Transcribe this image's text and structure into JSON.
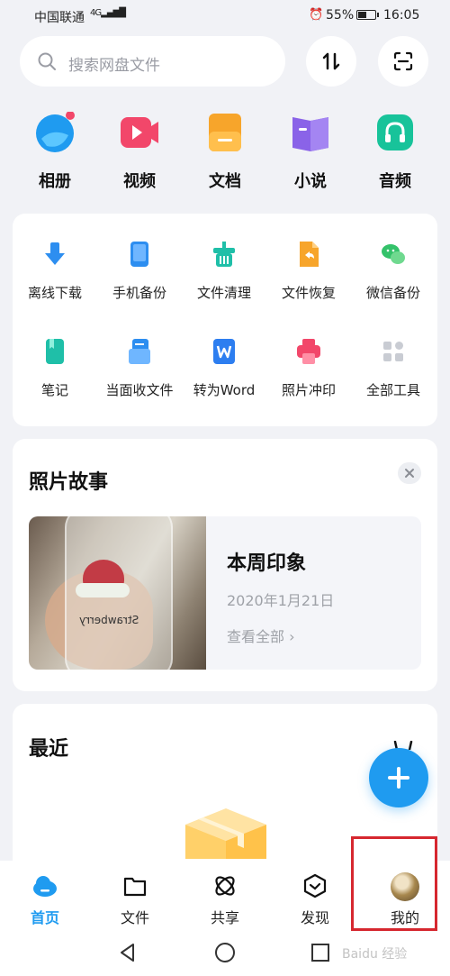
{
  "status_bar": {
    "carrier": "中国联通",
    "signal": "4G",
    "battery": "55%",
    "battery_level": 0.55,
    "time": "16:05"
  },
  "search": {
    "placeholder": "搜索网盘文件",
    "icon": "search-icon"
  },
  "top_buttons": [
    {
      "icon": "transfer-arrows-icon"
    },
    {
      "icon": "scan-icon"
    }
  ],
  "categories": [
    {
      "label": "相册",
      "icon": "album-icon",
      "color": "#1f9bf0"
    },
    {
      "label": "视频",
      "icon": "video-icon",
      "color": "#f2476a"
    },
    {
      "label": "文档",
      "icon": "document-icon",
      "color": "#f7a52b"
    },
    {
      "label": "小说",
      "icon": "novel-icon",
      "color": "#8a63e8"
    },
    {
      "label": "音频",
      "icon": "audio-icon",
      "color": "#18c39a"
    }
  ],
  "tools": [
    {
      "label": "离线下载",
      "icon": "download-icon",
      "color": "#2d8ef0"
    },
    {
      "label": "手机备份",
      "icon": "phone-backup-icon",
      "color": "#2d8ef0"
    },
    {
      "label": "文件清理",
      "icon": "clean-icon",
      "color": "#1fbfa8"
    },
    {
      "label": "文件恢复",
      "icon": "restore-icon",
      "color": "#f7a52b"
    },
    {
      "label": "微信备份",
      "icon": "wechat-icon",
      "color": "#34c26a"
    },
    {
      "label": "笔记",
      "icon": "note-icon",
      "color": "#1fbfa8"
    },
    {
      "label": "当面收文件",
      "icon": "receive-file-icon",
      "color": "#2d8ef0"
    },
    {
      "label": "转为Word",
      "icon": "word-icon",
      "color": "#2d7ef0"
    },
    {
      "label": "照片冲印",
      "icon": "print-icon",
      "color": "#f2476a"
    },
    {
      "label": "全部工具",
      "icon": "all-tools-icon",
      "color": "#c9ccd3"
    }
  ],
  "photo_story": {
    "title": "照片故事",
    "headline": "本周印象",
    "date": "2020年1月21日",
    "more": "查看全部",
    "photo_text": "Strawberry"
  },
  "recent": {
    "title": "最近"
  },
  "nav": [
    {
      "label": "首页",
      "icon": "home-cloud-icon",
      "active": true
    },
    {
      "label": "文件",
      "icon": "folder-icon",
      "active": false
    },
    {
      "label": "共享",
      "icon": "share-icon",
      "active": false
    },
    {
      "label": "发现",
      "icon": "discover-icon",
      "active": false
    },
    {
      "label": "我的",
      "icon": "avatar",
      "active": false
    }
  ],
  "watermark": "Baidu 经验",
  "accent": "#1f9bf0",
  "highlight_color": "#d6272f"
}
